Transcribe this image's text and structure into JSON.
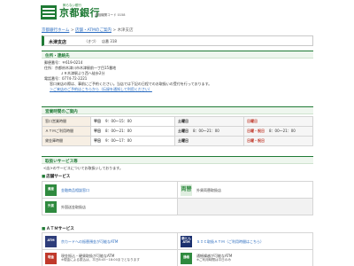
{
  "header": {
    "tagline": "飾らない銀行",
    "bank_name": "京都銀行",
    "bank_code": "金融機関コード 0158"
  },
  "breadcrumb": {
    "items": [
      "京都銀行ホーム",
      "店舗・ATMのご案内"
    ],
    "current": "木津支店",
    "separator": ">"
  },
  "branch": {
    "name": "木津支店",
    "kana": "（きづ）",
    "store_no": "店番 318"
  },
  "sections": {
    "address": "住所・連絡先",
    "hours": "営業時間のご案内",
    "services": "取扱いサービス等"
  },
  "address": {
    "postal": "郵便番号：〒619-0214",
    "addr_line1": "住所：京都府木津川市木津駅前一丁目15番地",
    "addr_line2": "ＪＲ木津駅より西へ徒歩2分",
    "phone": "電話番号：0774-72-2221",
    "notice": "窓口来店の際は、事前にご予約ください。当店では下記の日程でのお取扱いの受付を行っております。",
    "notice_link": "＞ご来店のご予約はこちらから（伝録を通知して利用ください）"
  },
  "hours": {
    "weekday_label": "平日",
    "sat_label": "土曜日",
    "sun_label": "日曜日",
    "sun_hol_label": "日曜・祝日",
    "rows": [
      {
        "service": "窓口営業時間",
        "weekday": "9：00～15：00",
        "sat": "",
        "sun": ""
      },
      {
        "service": "ＡＴＭご利用時間",
        "weekday": "8：00～21：00",
        "sat": "8：00～21：00",
        "sun": "8：00～21：00"
      },
      {
        "service": "貸金庫時間",
        "weekday": "9：00～17：00",
        "sat": "",
        "sun": ""
      }
    ]
  },
  "services": {
    "intro": "<店>のサービスについてお取扱いしております。",
    "store_head": "店舗サービス",
    "store_items": [
      {
        "icon": "資産",
        "label": "金融商品相談窓口"
      },
      {
        "icon": "両替",
        "label": "外貨両替取扱店"
      },
      {
        "icon": "外貨",
        "label": "外国送金取扱店"
      }
    ],
    "atm_head": "ＡＴＭサービス",
    "atm_items": [
      {
        "icon": "ATM",
        "label": "京カードへの振替預金が可能なATM"
      },
      {
        "icon": "新とんATM",
        "label": "ＳＩＣ取扱ＡＴＭ（ご利用時間はこちら）"
      },
      {
        "icon": "現金",
        "label": "現金振込・硬貨取扱が可能なATM",
        "sub": "※現金による振込は、平日8:45~18:00までとなります"
      },
      {
        "icon": "通帳",
        "label": "通帳繰越が可能なATM",
        "sub": "※ご利用時間は平日のみ"
      }
    ]
  },
  "colors": {
    "brand_green": "#1f7a35",
    "link_blue": "#2a6bbf"
  }
}
